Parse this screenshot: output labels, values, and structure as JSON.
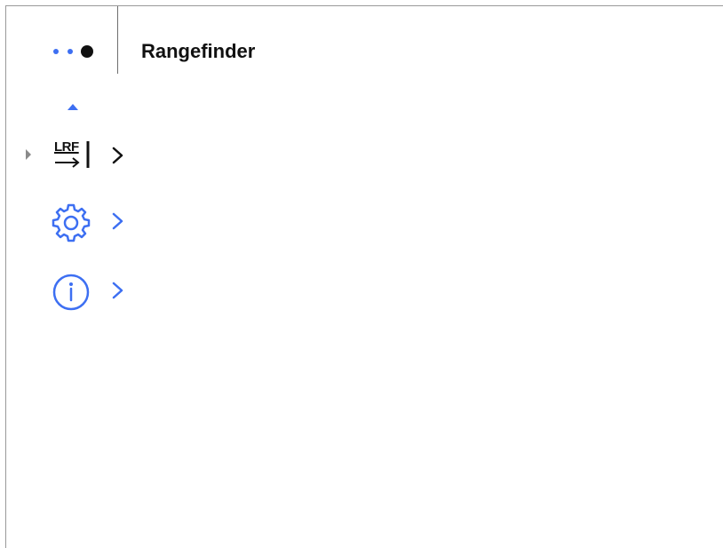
{
  "header": {
    "title": "Rangefinder",
    "page_indicator": {
      "total": 3,
      "current": 3
    }
  },
  "colors": {
    "accent": "#3d6ff2",
    "text": "#111111",
    "caret": "#8a8a8a",
    "frame": "#9a9a9a"
  },
  "menu": {
    "scroll_up_icon": "triangle-up-icon",
    "selected_index": 0,
    "items": [
      {
        "icon": "lrf-icon",
        "icon_text": "LRF",
        "chevron": "chevron-right-icon"
      },
      {
        "icon": "gear-icon",
        "chevron": "chevron-right-icon"
      },
      {
        "icon": "info-icon",
        "chevron": "chevron-right-icon"
      }
    ]
  }
}
